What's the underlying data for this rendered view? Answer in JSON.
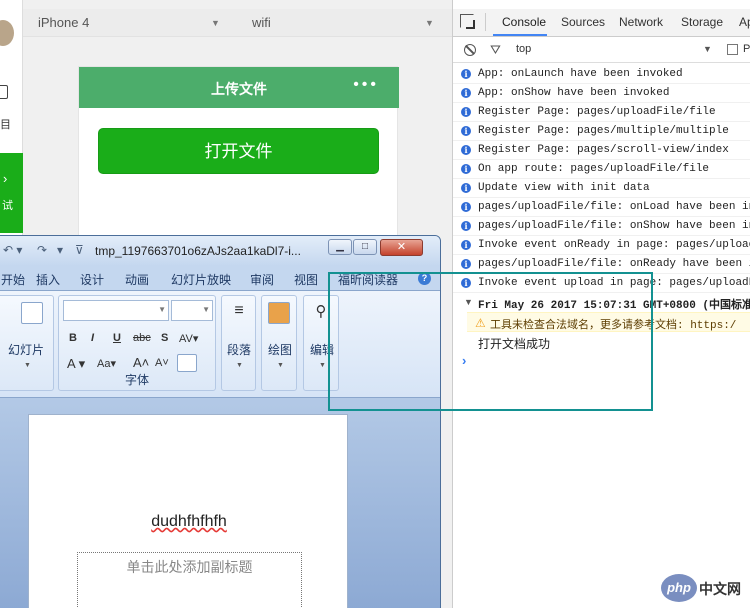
{
  "simulator": {
    "strip_label": "目",
    "strip_green_label": "试",
    "device": "iPhone 4",
    "network": "wifi"
  },
  "phone": {
    "nav_title": "上传文件",
    "menu_dots": "•••",
    "open_button": "打开文件"
  },
  "devtools": {
    "tabs": [
      "Console",
      "Sources",
      "Network",
      "Storage",
      "Ap"
    ],
    "context": "top",
    "preserve_label": "P",
    "logs": [
      "App: onLaunch have been invoked",
      "App: onShow have been invoked",
      "Register Page: pages/uploadFile/file",
      "Register Page: pages/multiple/multiple",
      "Register Page: pages/scroll-view/index",
      "On app route: pages/uploadFile/file",
      "Update view with init data",
      "pages/uploadFile/file: onLoad have been in",
      "pages/uploadFile/file: onShow have been in",
      "Invoke event onReady in page: pages/uploac",
      "pages/uploadFile/file: onReady have been i",
      "Invoke event upload in page: pages/uploadF"
    ],
    "group_header": "Fri May 26 2017 15:07:31 GMT+0800 (中国标准",
    "warning": "工具未检查合法域名，更多请参考文档: https:/",
    "success_msg": "打开文档成功"
  },
  "powerpoint": {
    "filename": "tmp_1197663701o6zAJs2aa1kaDl7-i...",
    "tabs": [
      "开始",
      "插入",
      "设计",
      "动画",
      "幻灯片放映",
      "审阅",
      "视图",
      "福昕阅读器"
    ],
    "groups": {
      "slides": "幻灯片",
      "font": "字体",
      "paragraph": "段落",
      "drawing": "绘图",
      "editing": "编辑"
    },
    "slide_title": "dudhfhfhfh",
    "subtitle_placeholder": "单击此处添加副标题"
  },
  "watermark": {
    "logo": "php",
    "text": "中文网"
  },
  "colors": {
    "phone_header": "#4cad6b",
    "primary_button": "#1aad19",
    "highlight_box": "#139191",
    "info_icon": "#2f6bd6"
  }
}
